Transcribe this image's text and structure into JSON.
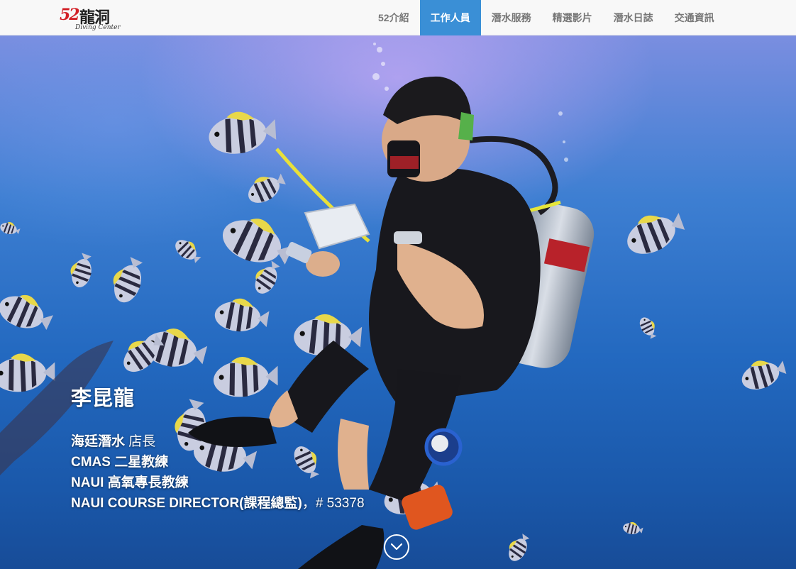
{
  "brand": {
    "logo_number": "52",
    "logo_text": "龍洞",
    "logo_subtitle": "Diving Center"
  },
  "nav": {
    "items": [
      {
        "label": "52介紹",
        "active": false
      },
      {
        "label": "工作人員",
        "active": true
      },
      {
        "label": "潛水服務",
        "active": false
      },
      {
        "label": "精選影片",
        "active": false
      },
      {
        "label": "潛水日誌",
        "active": false
      },
      {
        "label": "交通資訊",
        "active": false
      }
    ]
  },
  "hero": {
    "name": "李昆龍",
    "lines": [
      {
        "bold": "海廷潛水",
        "normal": " 店長"
      },
      {
        "bold": "CMAS 二星教練",
        "normal": ""
      },
      {
        "bold": "NAUI 高氧專長教練",
        "normal": ""
      },
      {
        "bold": "NAUI COURSE DIRECTOR(課程總監)",
        "normal": "，# 53378"
      }
    ]
  },
  "colors": {
    "nav_active_bg": "#3a8fd6",
    "nav_text": "#777777",
    "logo_red": "#d21f26"
  },
  "icons": {
    "scroll_down": "chevron-down-icon"
  }
}
